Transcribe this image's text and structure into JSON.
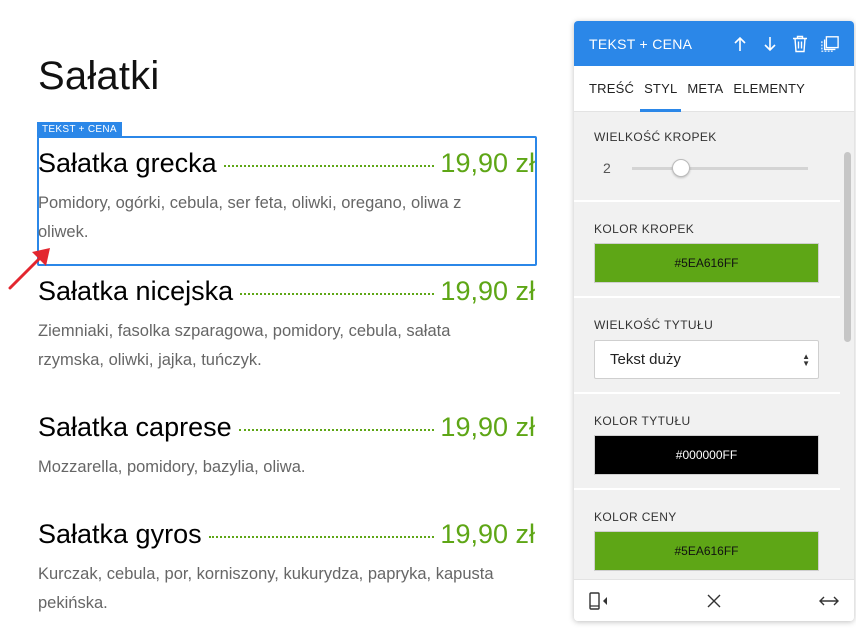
{
  "menu": {
    "section_title": "Sałatki",
    "selection_tag": "TEKST + CENA",
    "items": [
      {
        "name": "Sałatka grecka",
        "price": "19,90 zł",
        "description": "Pomidory, ogórki, cebula, ser feta, oliwki, oregano, oliwa z oliwek."
      },
      {
        "name": "Sałatka nicejska",
        "price": "19,90 zł",
        "description": "Ziemniaki, fasolka szparagowa, pomidory, cebula, sałata rzymska, oliwki, jajka, tuńczyk."
      },
      {
        "name": "Sałatka caprese",
        "price": "19,90 zł",
        "description": "Mozzarella, pomidory, bazylia, oliwa."
      },
      {
        "name": "Sałatka gyros",
        "price": "19,90 zł",
        "description": "Kurczak, cebula, por, korniszony, kukurydza, papryka, kapusta pekińska."
      }
    ]
  },
  "panel": {
    "title": "TEKST + CENA",
    "header_icons": [
      "arrow-up-icon",
      "arrow-down-icon",
      "trash-icon",
      "duplicate-icon"
    ],
    "tabs": [
      {
        "label": "TREŚĆ",
        "active": false
      },
      {
        "label": "STYL",
        "active": true
      },
      {
        "label": "META",
        "active": false
      },
      {
        "label": "ELEMENTY",
        "active": false
      }
    ],
    "fields": {
      "dot_size": {
        "label": "WIELKOŚĆ KROPEK",
        "value": "2"
      },
      "dot_color": {
        "label": "KOLOR KROPEK",
        "value": "#5EA616FF",
        "color": "#5EA616"
      },
      "title_size": {
        "label": "WIELKOŚĆ TYTUŁU",
        "selected": "Tekst duży"
      },
      "title_color": {
        "label": "KOLOR TYTUŁU",
        "value": "#000000FF",
        "color": "#000000"
      },
      "price_color": {
        "label": "KOLOR CENY",
        "value": "#5EA616FF",
        "color": "#5EA616"
      }
    },
    "footer_icons": [
      "mobile-view-icon",
      "close-icon",
      "expand-width-icon"
    ]
  },
  "colors": {
    "accent": "#2b87e8",
    "price": "#5EA616"
  }
}
